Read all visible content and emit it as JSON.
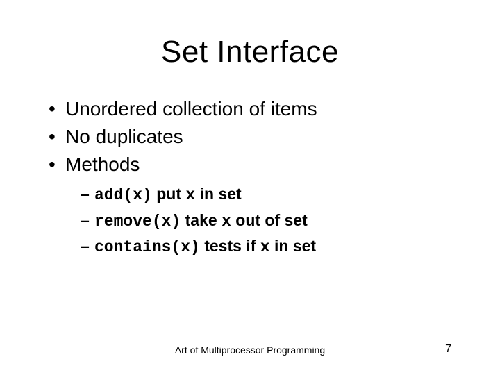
{
  "title": "Set Interface",
  "bullets": [
    {
      "text": "Unordered collection of items"
    },
    {
      "text": "No duplicates"
    },
    {
      "text": "Methods"
    }
  ],
  "methods": [
    {
      "code": "add(x)",
      "desc_before": " put ",
      "var": "x",
      "desc_after": " in set"
    },
    {
      "code": "remove(x)",
      "desc_before": " take ",
      "var": "x",
      "desc_after": " out of set"
    },
    {
      "code": "contains(x)",
      "desc_before": " tests if ",
      "var": "x",
      "desc_after": " in set"
    }
  ],
  "footer": "Art of Multiprocessor Programming",
  "page_number": "7"
}
